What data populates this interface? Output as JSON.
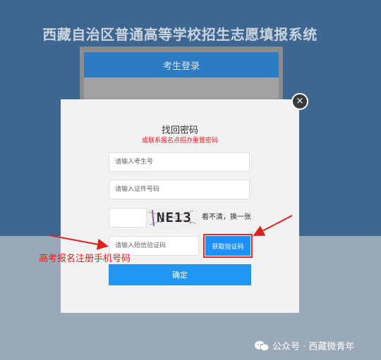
{
  "page": {
    "system_title": "西藏自治区普通高等学校招生志愿填报系统"
  },
  "login_card": {
    "header": "考生登录"
  },
  "modal": {
    "close_icon": "×",
    "title": "找回密码",
    "subtitle": "或联系报名点招办重置密码",
    "fields": {
      "exam_number_placeholder": "请输入考生号",
      "id_number_placeholder": "请输入证件号码",
      "captcha_placeholder": "",
      "sms_code_placeholder": "请输入短信验证码"
    },
    "captcha": {
      "text": "NE13",
      "refresh_label": "看不清，换一张"
    },
    "sms_button_label": "获取验证码",
    "confirm_button_label": "确定"
  },
  "annotation": {
    "text": "高考报名注册手机号码",
    "color": "#e02020"
  },
  "watermark": {
    "text": "公众号 · 西藏微青年",
    "icon": "wechat-icon"
  },
  "colors": {
    "background_top": "#3d6690",
    "background_bottom": "#9aa9b8",
    "header_blue": "#2d7bc2",
    "button_blue": "#2196f3",
    "alert_red": "#e02020"
  }
}
